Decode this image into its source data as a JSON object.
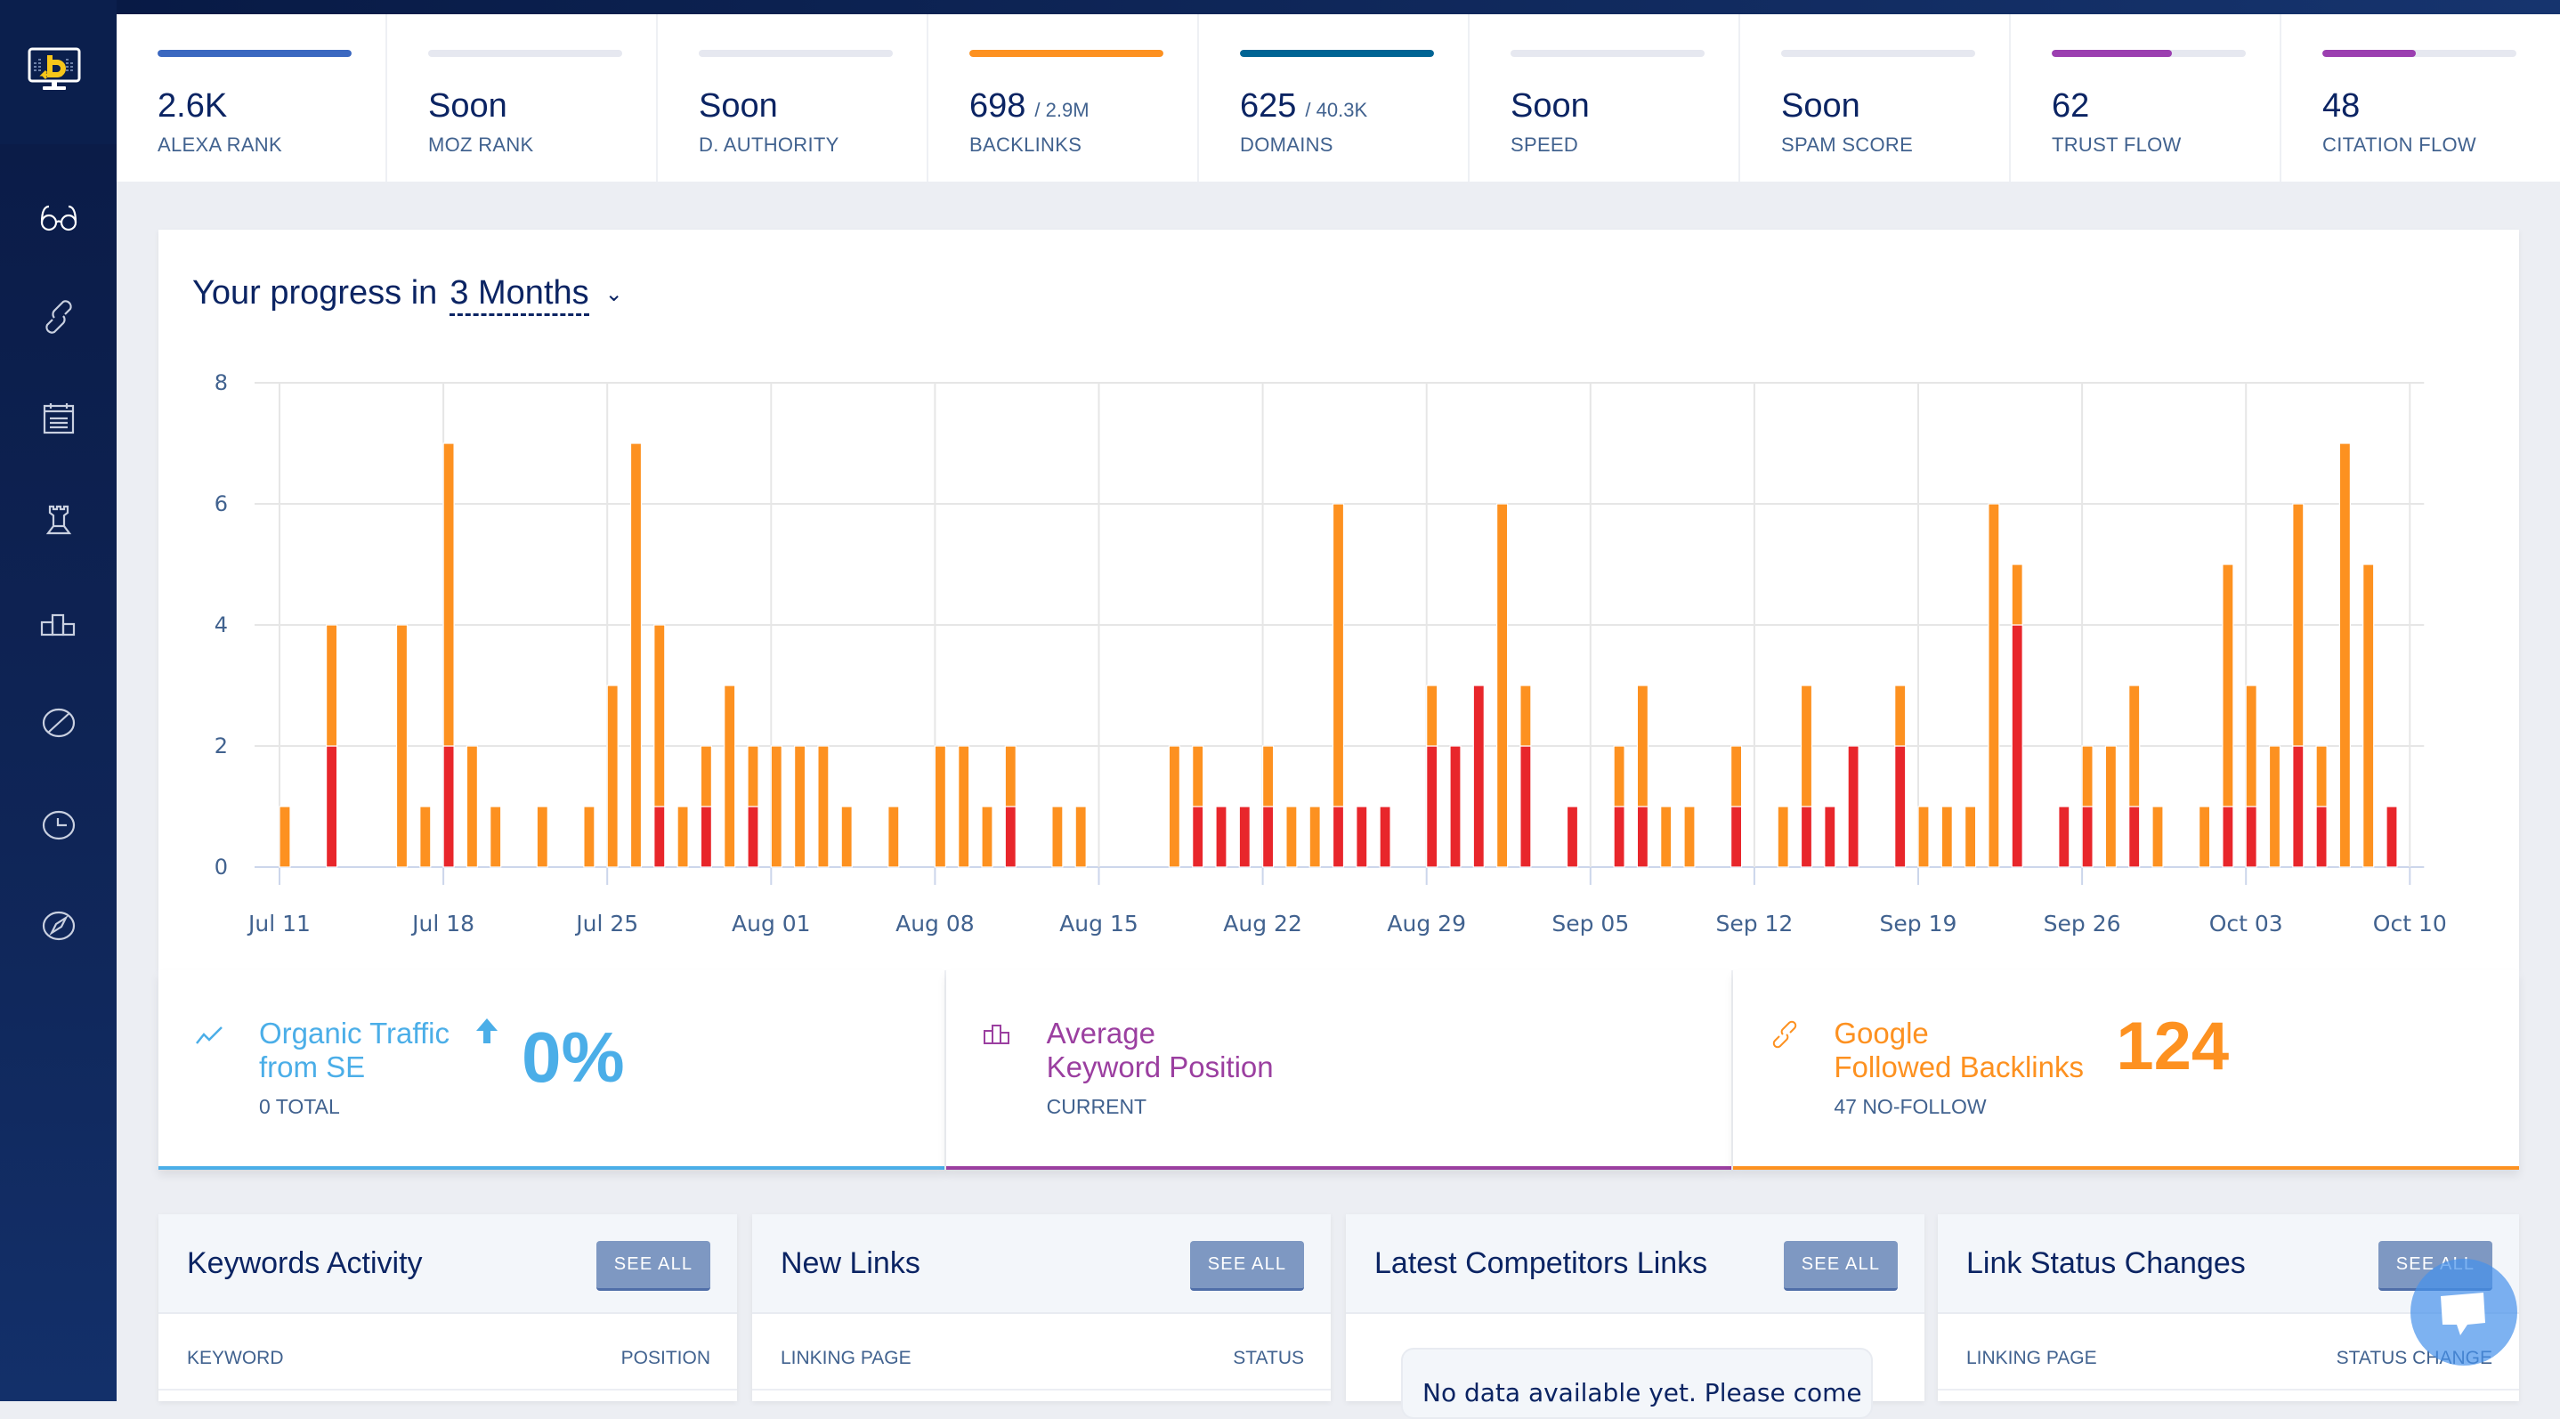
{
  "sidebar": {
    "logo": "brand-logo",
    "items": [
      {
        "name": "glasses-icon",
        "active": true
      },
      {
        "name": "link-icon",
        "active": false
      },
      {
        "name": "calendar-icon",
        "active": false
      },
      {
        "name": "rook-icon",
        "active": false
      },
      {
        "name": "podium-icon",
        "active": false
      },
      {
        "name": "slash-circle-icon",
        "active": false
      },
      {
        "name": "clock-icon",
        "active": false
      },
      {
        "name": "compass-icon",
        "active": false
      }
    ]
  },
  "metrics": [
    {
      "value": "2.6K",
      "sub": "",
      "label": "ALEXA RANK",
      "bar_fill": 1.0,
      "bar_color": "#3b68c0"
    },
    {
      "value": "Soon",
      "sub": "",
      "label": "MOZ RANK",
      "bar_fill": 0,
      "bar_color": "#e6e8f0"
    },
    {
      "value": "Soon",
      "sub": "",
      "label": "D. AUTHORITY",
      "bar_fill": 0,
      "bar_color": "#e6e8f0"
    },
    {
      "value": "698",
      "sub": "/ 2.9M",
      "label": "BACKLINKS",
      "bar_fill": 1.0,
      "bar_color": "#fd9120"
    },
    {
      "value": "625",
      "sub": "/ 40.3K",
      "label": "DOMAINS",
      "bar_fill": 1.0,
      "bar_color": "#006494"
    },
    {
      "value": "Soon",
      "sub": "",
      "label": "SPEED",
      "bar_fill": 0,
      "bar_color": "#e6e8f0"
    },
    {
      "value": "Soon",
      "sub": "",
      "label": "SPAM SCORE",
      "bar_fill": 0,
      "bar_color": "#e6e8f0"
    },
    {
      "value": "62",
      "sub": "",
      "label": "TRUST FLOW",
      "bar_fill": 0.62,
      "bar_color": "#9b3fb0"
    },
    {
      "value": "48",
      "sub": "",
      "label": "CITATION FLOW",
      "bar_fill": 0.48,
      "bar_color": "#9b3fb0"
    }
  ],
  "progress": {
    "title": "Your progress in",
    "period": "3 Months"
  },
  "chart_data": {
    "type": "bar",
    "stacked": true,
    "title": "Your progress in 3 Months",
    "xlabel": "",
    "ylabel": "",
    "ylim": [
      0,
      8
    ],
    "yticks": [
      0,
      2,
      4,
      6,
      8
    ],
    "grid": true,
    "start_date": "Jul 11",
    "num_days": 92,
    "xtick_labels": [
      "Jul 11",
      "Jul 18",
      "Jul 25",
      "Aug 01",
      "Aug 08",
      "Aug 15",
      "Aug 22",
      "Aug 29",
      "Sep 05",
      "Sep 12",
      "Sep 19",
      "Sep 26",
      "Oct 03",
      "Oct 10"
    ],
    "series_colors": {
      "orange": "#fd9120",
      "red": "#e8262b"
    },
    "bars": [
      {
        "day": 0,
        "red": 0,
        "orange": 1
      },
      {
        "day": 2,
        "red": 2,
        "orange": 2
      },
      {
        "day": 5,
        "red": 0,
        "orange": 4
      },
      {
        "day": 6,
        "red": 0,
        "orange": 1
      },
      {
        "day": 7,
        "red": 2,
        "orange": 5
      },
      {
        "day": 8,
        "red": 0,
        "orange": 2
      },
      {
        "day": 9,
        "red": 0,
        "orange": 1
      },
      {
        "day": 11,
        "red": 0,
        "orange": 1
      },
      {
        "day": 13,
        "red": 0,
        "orange": 1
      },
      {
        "day": 14,
        "red": 0,
        "orange": 3
      },
      {
        "day": 15,
        "red": 0,
        "orange": 7
      },
      {
        "day": 16,
        "red": 1,
        "orange": 3
      },
      {
        "day": 17,
        "red": 0,
        "orange": 1
      },
      {
        "day": 18,
        "red": 1,
        "orange": 1
      },
      {
        "day": 19,
        "red": 0,
        "orange": 3
      },
      {
        "day": 20,
        "red": 1,
        "orange": 1
      },
      {
        "day": 21,
        "red": 0,
        "orange": 2
      },
      {
        "day": 22,
        "red": 0,
        "orange": 2
      },
      {
        "day": 23,
        "red": 0,
        "orange": 2
      },
      {
        "day": 24,
        "red": 0,
        "orange": 1
      },
      {
        "day": 26,
        "red": 0,
        "orange": 1
      },
      {
        "day": 28,
        "red": 0,
        "orange": 2
      },
      {
        "day": 29,
        "red": 0,
        "orange": 2
      },
      {
        "day": 30,
        "red": 0,
        "orange": 1
      },
      {
        "day": 31,
        "red": 1,
        "orange": 1
      },
      {
        "day": 33,
        "red": 0,
        "orange": 1
      },
      {
        "day": 34,
        "red": 0,
        "orange": 1
      },
      {
        "day": 38,
        "red": 0,
        "orange": 2
      },
      {
        "day": 39,
        "red": 1,
        "orange": 1
      },
      {
        "day": 40,
        "red": 1,
        "orange": 0
      },
      {
        "day": 41,
        "red": 1,
        "orange": 0
      },
      {
        "day": 42,
        "red": 1,
        "orange": 1
      },
      {
        "day": 43,
        "red": 0,
        "orange": 1
      },
      {
        "day": 44,
        "red": 0,
        "orange": 1
      },
      {
        "day": 45,
        "red": 1,
        "orange": 5
      },
      {
        "day": 46,
        "red": 1,
        "orange": 0
      },
      {
        "day": 47,
        "red": 1,
        "orange": 0
      },
      {
        "day": 49,
        "red": 2,
        "orange": 1
      },
      {
        "day": 50,
        "red": 2,
        "orange": 0
      },
      {
        "day": 51,
        "red": 3,
        "orange": 0
      },
      {
        "day": 52,
        "red": 0,
        "orange": 6
      },
      {
        "day": 53,
        "red": 2,
        "orange": 1
      },
      {
        "day": 55,
        "red": 1,
        "orange": 0
      },
      {
        "day": 57,
        "red": 1,
        "orange": 1
      },
      {
        "day": 58,
        "red": 1,
        "orange": 2
      },
      {
        "day": 59,
        "red": 0,
        "orange": 1
      },
      {
        "day": 60,
        "red": 0,
        "orange": 1
      },
      {
        "day": 62,
        "red": 1,
        "orange": 1
      },
      {
        "day": 64,
        "red": 0,
        "orange": 1
      },
      {
        "day": 65,
        "red": 1,
        "orange": 2
      },
      {
        "day": 66,
        "red": 1,
        "orange": 0
      },
      {
        "day": 67,
        "red": 2,
        "orange": 0
      },
      {
        "day": 69,
        "red": 2,
        "orange": 1
      },
      {
        "day": 70,
        "red": 0,
        "orange": 1
      },
      {
        "day": 71,
        "red": 0,
        "orange": 1
      },
      {
        "day": 72,
        "red": 0,
        "orange": 1
      },
      {
        "day": 73,
        "red": 0,
        "orange": 6
      },
      {
        "day": 74,
        "red": 4,
        "orange": 1
      },
      {
        "day": 76,
        "red": 1,
        "orange": 0
      },
      {
        "day": 77,
        "red": 1,
        "orange": 1
      },
      {
        "day": 78,
        "red": 0,
        "orange": 2
      },
      {
        "day": 79,
        "red": 1,
        "orange": 2
      },
      {
        "day": 80,
        "red": 0,
        "orange": 1
      },
      {
        "day": 82,
        "red": 0,
        "orange": 1
      },
      {
        "day": 83,
        "red": 1,
        "orange": 4
      },
      {
        "day": 84,
        "red": 1,
        "orange": 2
      },
      {
        "day": 85,
        "red": 0,
        "orange": 2
      },
      {
        "day": 86,
        "red": 2,
        "orange": 4
      },
      {
        "day": 87,
        "red": 1,
        "orange": 1
      },
      {
        "day": 88,
        "red": 0,
        "orange": 7
      },
      {
        "day": 89,
        "red": 0,
        "orange": 5
      },
      {
        "day": 90,
        "red": 1,
        "orange": 0
      }
    ]
  },
  "summary": [
    {
      "title_line1": "Organic Traffic",
      "title_line2": "from SE",
      "value": "0%",
      "caption": "0 TOTAL",
      "color": "#4baee8",
      "icon": "trend-line-icon",
      "trend_icon": "arrow-up-icon"
    },
    {
      "title_line1": "Average",
      "title_line2": "Keyword Position",
      "value": "",
      "caption": "CURRENT",
      "color": "#9b3fa0",
      "icon": "podium-icon"
    },
    {
      "title_line1": "Google",
      "title_line2": "Followed Backlinks",
      "value": "124",
      "caption": "47 NO-FOLLOW",
      "color": "#fd9120",
      "icon": "link-icon"
    }
  ],
  "panels": [
    {
      "title": "Keywords Activity",
      "button": "SEE ALL",
      "columns": [
        "KEYWORD",
        "POSITION"
      ],
      "empty_message": ""
    },
    {
      "title": "New Links",
      "button": "SEE ALL",
      "columns": [
        "LINKING PAGE",
        "STATUS"
      ],
      "empty_message": ""
    },
    {
      "title": "Latest Competitors Links",
      "button": "SEE ALL",
      "columns": [],
      "empty_message": "No data available yet. Please come"
    },
    {
      "title": "Link Status Changes",
      "button": "SEE ALL",
      "columns": [
        "LINKING PAGE",
        "STATUS CHANGE"
      ],
      "empty_message": ""
    }
  ],
  "chat": {
    "icon": "chat-bubble-icon"
  }
}
